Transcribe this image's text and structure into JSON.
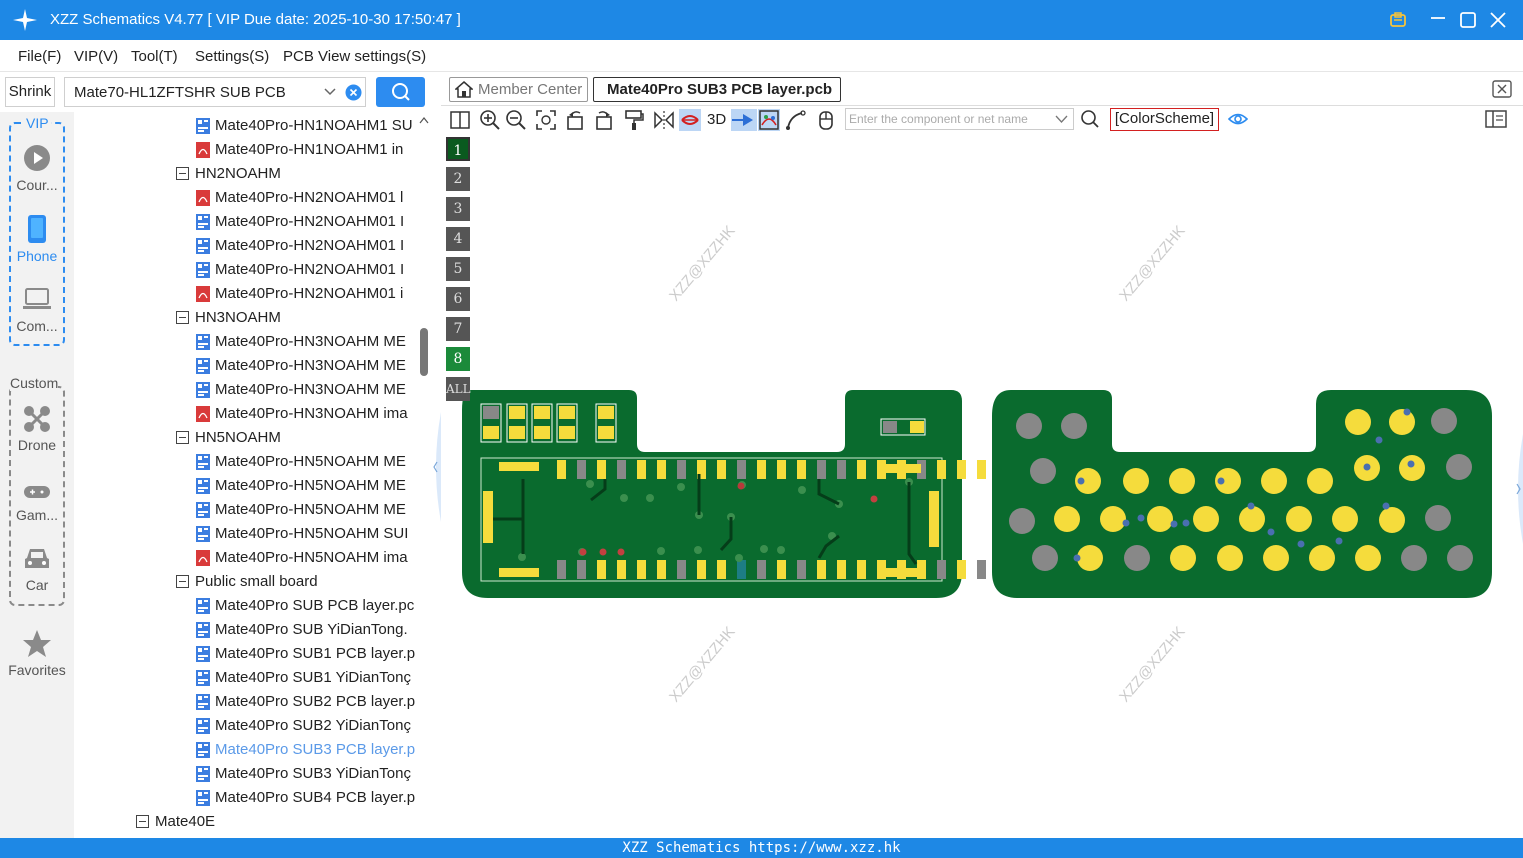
{
  "titlebar": {
    "title": "XZZ Schematics V4.77 [ VIP Due date: 2025-10-30 17:50:47 ]"
  },
  "menu": [
    "File(F)",
    "VIP(V)",
    "Tool(T)",
    "Settings(S)",
    "PCB View settings(S)"
  ],
  "leftpanel": {
    "shrink_label": "Shrink",
    "board_select_value": "Mate70-HL1ZFTSHR SUB PCB"
  },
  "rail": {
    "vip_label": "VIP",
    "custom_label": "Custom",
    "items": [
      {
        "label": "Cour...",
        "icon": "play-icon"
      },
      {
        "label": "Phone",
        "icon": "phone-icon"
      },
      {
        "label": "Com...",
        "icon": "laptop-icon"
      },
      {
        "label": "Drone",
        "icon": "drone-icon"
      },
      {
        "label": "Gam...",
        "icon": "gamepad-icon"
      },
      {
        "label": "Car",
        "icon": "car-icon"
      },
      {
        "label": "Favorites",
        "icon": "star-icon"
      }
    ]
  },
  "tree": [
    {
      "type": "file",
      "icon": "pcb",
      "text": "Mate40Pro-HN1NOAHM1 SU"
    },
    {
      "type": "file",
      "icon": "pdf",
      "text": "Mate40Pro-HN1NOAHM1 in"
    },
    {
      "type": "folder",
      "text": "HN2NOAHM"
    },
    {
      "type": "file",
      "icon": "pdf",
      "text": "Mate40Pro-HN2NOAHM01 l"
    },
    {
      "type": "file",
      "icon": "pcb",
      "text": "Mate40Pro-HN2NOAHM01 I"
    },
    {
      "type": "file",
      "icon": "pcb",
      "text": "Mate40Pro-HN2NOAHM01 I"
    },
    {
      "type": "file",
      "icon": "pcb",
      "text": "Mate40Pro-HN2NOAHM01 I"
    },
    {
      "type": "file",
      "icon": "pdf",
      "text": "Mate40Pro-HN2NOAHM01 i"
    },
    {
      "type": "folder",
      "text": "HN3NOAHM"
    },
    {
      "type": "file",
      "icon": "pcb",
      "text": "Mate40Pro-HN3NOAHM ME"
    },
    {
      "type": "file",
      "icon": "pcb",
      "text": "Mate40Pro-HN3NOAHM ME"
    },
    {
      "type": "file",
      "icon": "pcb",
      "text": "Mate40Pro-HN3NOAHM ME"
    },
    {
      "type": "file",
      "icon": "pdf",
      "text": "Mate40Pro-HN3NOAHM ima"
    },
    {
      "type": "folder",
      "text": "HN5NOAHM"
    },
    {
      "type": "file",
      "icon": "pcb",
      "text": "Mate40Pro-HN5NOAHM ME"
    },
    {
      "type": "file",
      "icon": "pcb",
      "text": "Mate40Pro-HN5NOAHM ME"
    },
    {
      "type": "file",
      "icon": "pcb",
      "text": "Mate40Pro-HN5NOAHM ME"
    },
    {
      "type": "file",
      "icon": "pcb",
      "text": "Mate40Pro-HN5NOAHM SUI"
    },
    {
      "type": "file",
      "icon": "pdf",
      "text": "Mate40Pro-HN5NOAHM ima"
    },
    {
      "type": "folder",
      "text": "Public small board"
    },
    {
      "type": "file",
      "icon": "pcb",
      "text": "Mate40Pro SUB PCB layer.pc"
    },
    {
      "type": "file",
      "icon": "pcb",
      "text": "Mate40Pro SUB YiDianTong."
    },
    {
      "type": "file",
      "icon": "pcb",
      "text": "Mate40Pro SUB1 PCB layer.p"
    },
    {
      "type": "file",
      "icon": "pcb",
      "text": "Mate40Pro SUB1 YiDianTonç"
    },
    {
      "type": "file",
      "icon": "pcb",
      "text": "Mate40Pro SUB2 PCB layer.p"
    },
    {
      "type": "file",
      "icon": "pcb",
      "text": "Mate40Pro SUB2 YiDianTonç"
    },
    {
      "type": "file",
      "icon": "pcb",
      "text": "Mate40Pro SUB3 PCB layer.p",
      "selected": true
    },
    {
      "type": "file",
      "icon": "pcb",
      "text": "Mate40Pro SUB3 YiDianTonç"
    },
    {
      "type": "file",
      "icon": "pcb",
      "text": "Mate40Pro SUB4 PCB layer.p"
    },
    {
      "type": "rootfolder",
      "text": "Mate40E"
    }
  ],
  "tabs": {
    "member_center": "Member Center",
    "active": "Mate40Pro SUB3 PCB layer.pcb"
  },
  "toolbar": {
    "label_3d": "3D",
    "search_placeholder": "Enter the component or net name",
    "color_scheme": "[ColorScheme]"
  },
  "layers": [
    "1",
    "2",
    "3",
    "4",
    "5",
    "6",
    "7",
    "8",
    "ALL"
  ],
  "watermark": "XZZ@XZZHK",
  "status": "XZZ Schematics https://www.xzz.hk",
  "colors": {
    "accent": "#1e88e5",
    "pcb_green": "#0a6b2e",
    "pad_yellow": "#f5dc3c",
    "pad_grey": "#888888",
    "selected_text": "#5b9ae8"
  }
}
